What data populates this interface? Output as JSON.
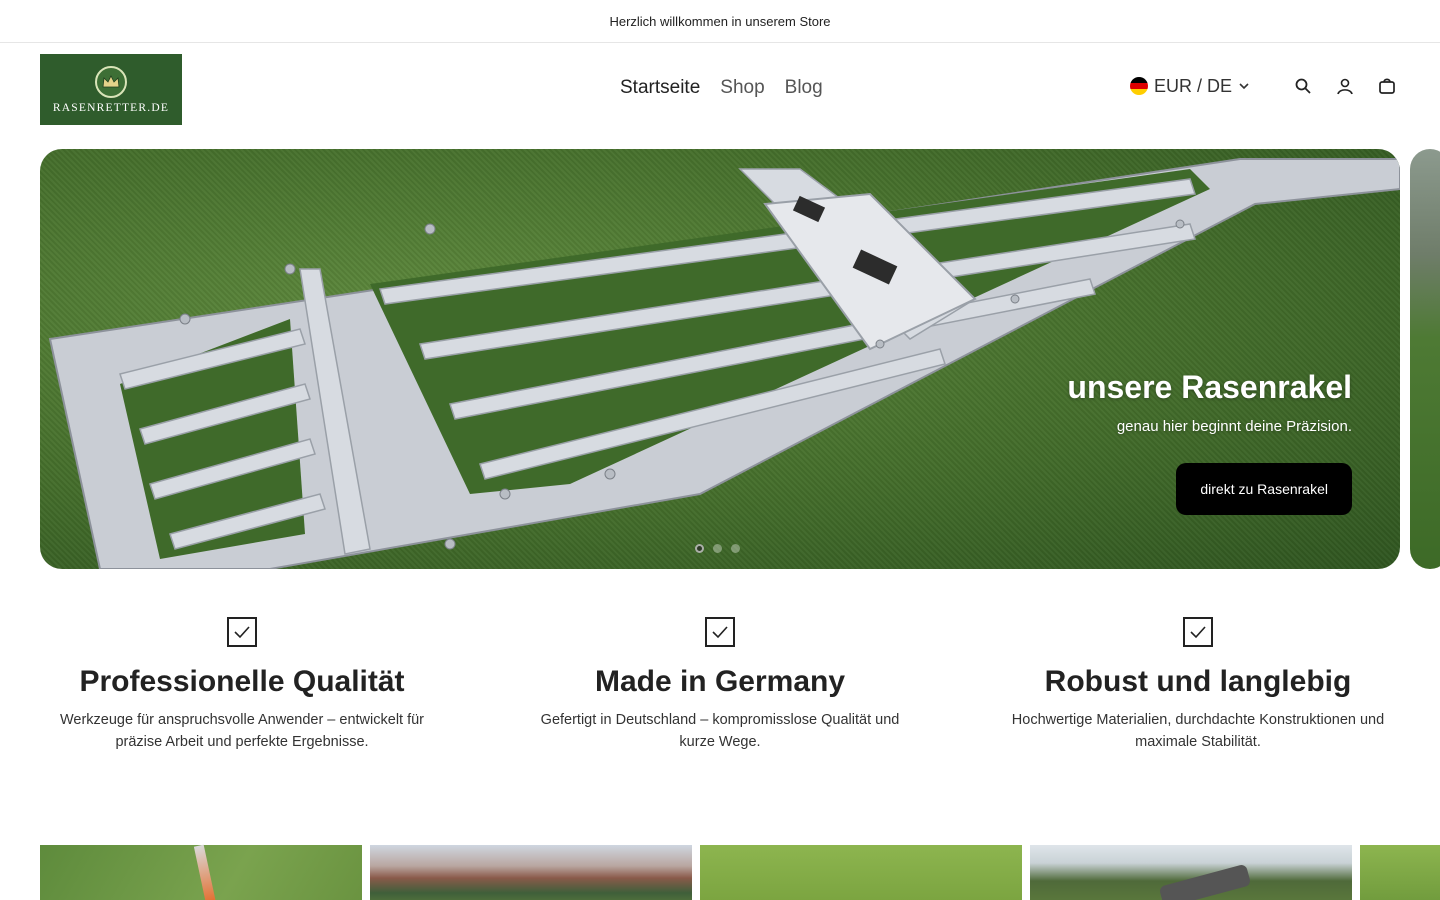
{
  "announcement": {
    "text": "Herzlich willkommen in unserem Store"
  },
  "header": {
    "logo_text": "RASENRETTER.DE",
    "nav": [
      {
        "label": "Startseite",
        "active": true
      },
      {
        "label": "Shop",
        "active": false
      },
      {
        "label": "Blog",
        "active": false
      }
    ],
    "currency": "EUR / DE",
    "icons": [
      "search-icon",
      "account-icon",
      "cart-icon"
    ]
  },
  "hero": {
    "title": "unsere Rasenrakel",
    "subtitle": "genau hier beginnt deine Präzision.",
    "button_label": "direkt zu Rasenrakel",
    "dots_count": 3,
    "active_dot": 1
  },
  "features": [
    {
      "title": "Professionelle Qualität",
      "text_line1": "Werkzeuge für anspruchsvolle Anwender – entwickelt für",
      "text_line2": "präzise Arbeit und perfekte Ergebnisse."
    },
    {
      "title": "Made in Germany",
      "text_line1": "Gefertigt in Deutschland – kompromisslose Qualität und",
      "text_line2": "kurze Wege."
    },
    {
      "title": "Robust und langlebig",
      "text_line1": "Hochwertige Materialien, durchdachte Konstruktionen und",
      "text_line2": "maximale Stabilität."
    }
  ],
  "colors": {
    "brand_green": "#2f5c2c",
    "button_black": "#000000"
  }
}
